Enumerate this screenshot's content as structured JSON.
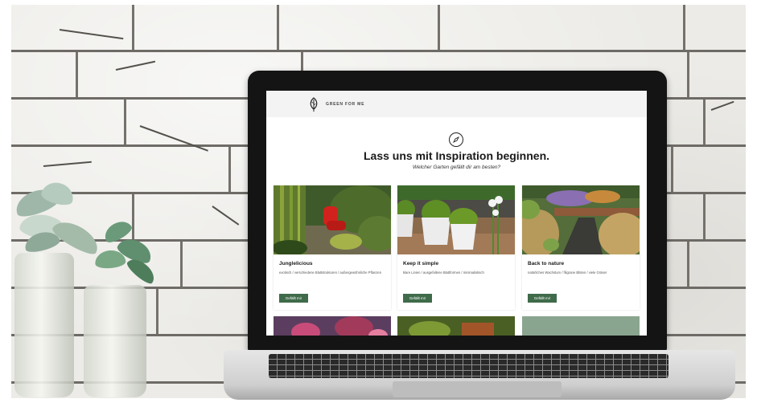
{
  "site": {
    "brand": "GREEN FOR ME"
  },
  "hero": {
    "title": "Lass uns mit Inspiration beginnen.",
    "subtitle": "Welcher Garten gefällt dir am besten?"
  },
  "cards": [
    {
      "title": "Junglelicious",
      "description": "exotisch / verschiedene Blattstrukturen / außergewöhnliche Pflanzen",
      "button": "Gefällt mir"
    },
    {
      "title": "Keep it simple",
      "description": "klare Linien / ausgefallene Blattformen / minimalistisch",
      "button": "Gefällt mir"
    },
    {
      "title": "Back to nature",
      "description": "natürliches Wachstum / filigrane Blüten / viele Gräser",
      "button": "Gefällt mir"
    }
  ],
  "colors": {
    "brand_green": "#3f6b4a",
    "card_bg_placeholder": "#8aa58f",
    "nav_bg": "#f3f3f3"
  },
  "icons": {
    "logo": "leaf-icon",
    "hero": "compass-icon"
  }
}
